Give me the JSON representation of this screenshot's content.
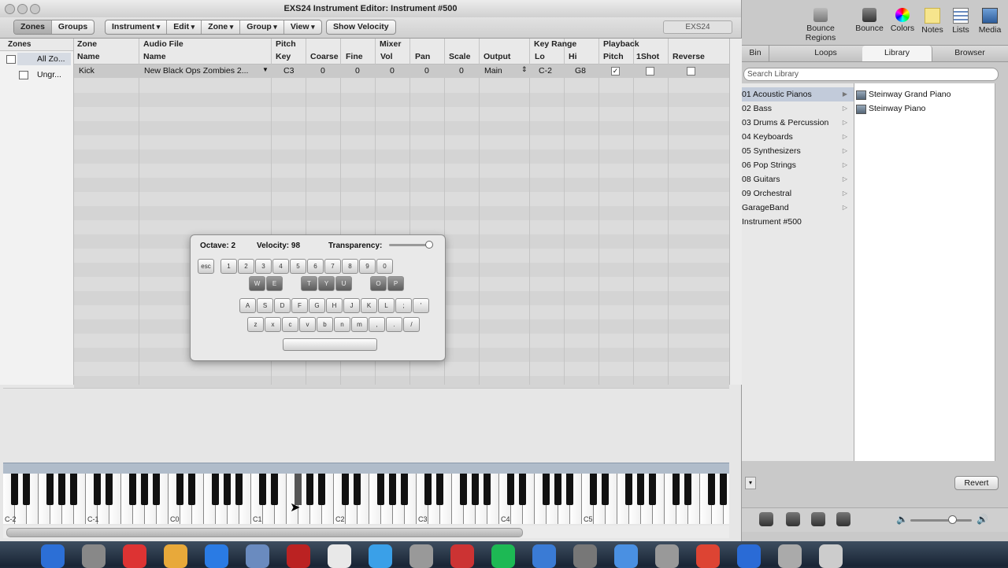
{
  "window": {
    "title": "EXS24 Instrument Editor: Instrument #500"
  },
  "toolbar": {
    "zones_label": "Zones",
    "groups_label": "Groups",
    "menus": [
      "Instrument",
      "Edit",
      "Zone",
      "Group",
      "View"
    ],
    "show_velocity_label": "Show Velocity",
    "exs_label": "EXS24"
  },
  "zones_panel": {
    "header": "Zones",
    "items": [
      {
        "label": "All Zo..."
      },
      {
        "label": "Ungr..."
      }
    ]
  },
  "table": {
    "group_headers": {
      "zone": "Zone",
      "audio_file": "Audio File",
      "pitch": "Pitch",
      "mixer": "Mixer",
      "key_range": "Key Range",
      "playback": "Playback"
    },
    "columns": [
      "Name",
      "Name",
      "Key",
      "Coarse",
      "Fine",
      "Vol",
      "Pan",
      "Scale",
      "Output",
      "Lo",
      "Hi",
      "Pitch",
      "1Shot",
      "Reverse"
    ],
    "row": {
      "zone_name": "Kick",
      "audio_file": "New Black Ops Zombies 2...",
      "key": "C3",
      "coarse": "0",
      "fine": "0",
      "vol": "0",
      "pan": "0",
      "scale": "0",
      "output": "Main",
      "lo": "C-2",
      "hi": "G8",
      "pitch_checked": true,
      "oneshot_checked": false,
      "reverse_checked": false
    }
  },
  "caps_keyboard": {
    "octave": "Octave: 2",
    "velocity": "Velocity: 98",
    "transparency_label": "Transparency:",
    "transparency_level": 1.0,
    "esc": "esc",
    "number_row": [
      "1",
      "2",
      "3",
      "4",
      "5",
      "6",
      "7",
      "8",
      "9",
      "0"
    ],
    "black_keys": [
      "W",
      "E",
      "T",
      "Y",
      "U",
      "O",
      "P"
    ],
    "white_keys": [
      "A",
      "S",
      "D",
      "F",
      "G",
      "H",
      "J",
      "K",
      "L",
      ";",
      "'"
    ],
    "bottom_row": [
      "z",
      "x",
      "c",
      "v",
      "b",
      "n",
      "m",
      ",",
      ".",
      "/"
    ]
  },
  "piano": {
    "octave_labels": [
      "C-2",
      "C-1",
      "C0",
      "C1",
      "C2",
      "C3",
      "C4",
      "C5"
    ]
  },
  "right_panel": {
    "tools": [
      {
        "label": "Bounce Regions",
        "icon": "bounce-regions-icon"
      },
      {
        "label": "Bounce",
        "icon": "bounce-icon"
      },
      {
        "label": "Colors",
        "icon": "colors-icon"
      },
      {
        "label": "Notes",
        "icon": "notes-icon"
      },
      {
        "label": "Lists",
        "icon": "lists-icon"
      },
      {
        "label": "Media",
        "icon": "media-icon"
      }
    ],
    "tabs": [
      "Bin",
      "Loops",
      "Library",
      "Browser"
    ],
    "selected_tab": "Library",
    "search_placeholder": "Search Library",
    "categories": [
      "01 Acoustic Pianos",
      "02 Bass",
      "03 Drums & Percussion",
      "04 Keyboards",
      "05 Synthesizers",
      "06 Pop Strings",
      "08 Guitars",
      "09 Orchestral",
      "GarageBand",
      "Instrument #500"
    ],
    "presets": [
      "Steinway Grand Piano",
      "Steinway Piano"
    ],
    "revert_label": "Revert"
  },
  "colors": {
    "selection": "#c2cbda",
    "dock": "#182434"
  }
}
